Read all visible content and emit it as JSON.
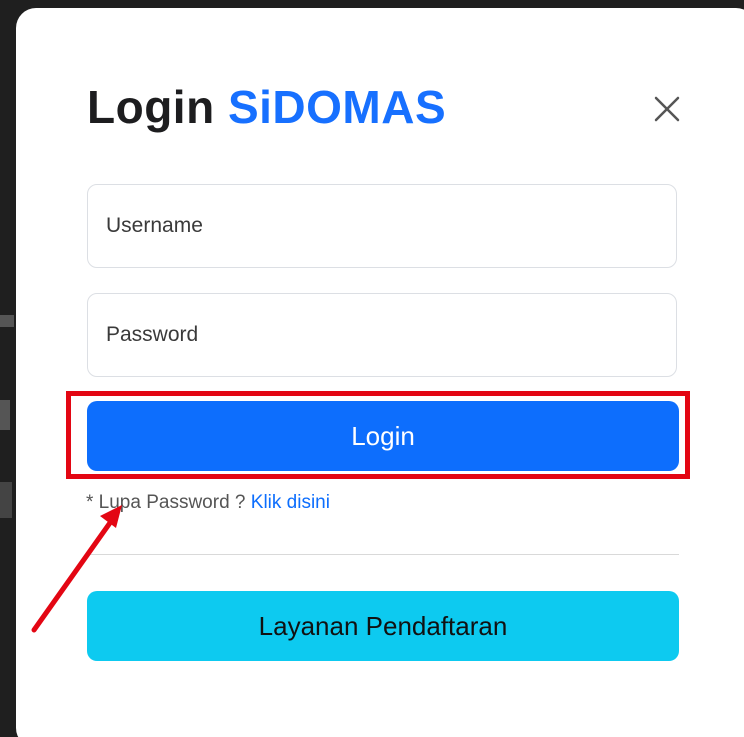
{
  "modal": {
    "title_prefix": "Login",
    "title_brand": "SiDOMAS",
    "close_icon": "close-icon",
    "username_placeholder": "Username",
    "password_placeholder": "Password",
    "login_label": "Login",
    "forgot_text": "* Lupa Password ?",
    "forgot_link": "Klik disini",
    "register_label": "Layanan Pendaftaran"
  },
  "annotation": {
    "highlight_color": "#e30613",
    "arrow_color": "#e30613"
  },
  "colors": {
    "brand": "#1770ff",
    "primary_button": "#0d6efd",
    "info_button": "#0dcaf0"
  }
}
